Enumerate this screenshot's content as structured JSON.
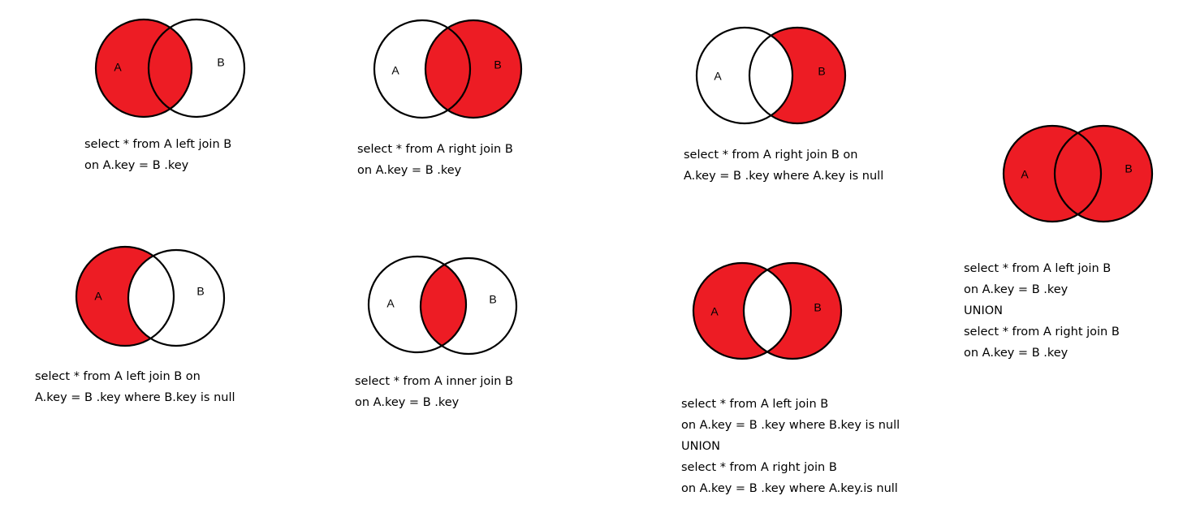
{
  "colors": {
    "fill": "#ed1c24",
    "stroke": "#000000",
    "background": "#ffffff"
  },
  "diagrams": [
    {
      "id": "left-join",
      "fill": "left-all",
      "label_a": "A",
      "label_b": "B",
      "caption": [
        "select * from A left join B",
        "on A.key = B .key"
      ]
    },
    {
      "id": "right-join",
      "fill": "right-all",
      "label_a": "A",
      "label_b": "B",
      "caption": [
        "select * from A right join B",
        "on A.key = B .key"
      ]
    },
    {
      "id": "right-only",
      "fill": "right-only",
      "label_a": "A",
      "label_b": "B",
      "caption": [
        "select * from A right join B on",
        "A.key = B .key where A.key is null"
      ]
    },
    {
      "id": "full-join",
      "fill": "full",
      "label_a": "A",
      "label_b": "B",
      "caption": [
        "select * from A left join B",
        "on A.key = B .key",
        "UNION",
        "select * from A right join B",
        "on A.key = B .key"
      ]
    },
    {
      "id": "left-only",
      "fill": "left-only",
      "label_a": "A",
      "label_b": "B",
      "caption": [
        "select * from A left join B on",
        "A.key = B .key where B.key is null"
      ]
    },
    {
      "id": "inner-join",
      "fill": "intersection",
      "label_a": "A",
      "label_b": "B",
      "caption": [
        "select * from A inner join B",
        "on A.key = B .key"
      ]
    },
    {
      "id": "symmetric-difference",
      "fill": "symmetric-difference",
      "label_a": "A",
      "label_b": "B",
      "caption": [
        "select * from A left join B",
        "on A.key = B .key where B.key is null",
        "UNION",
        "select * from A right join B",
        "on A.key = B .key where A.key.is null"
      ]
    }
  ]
}
